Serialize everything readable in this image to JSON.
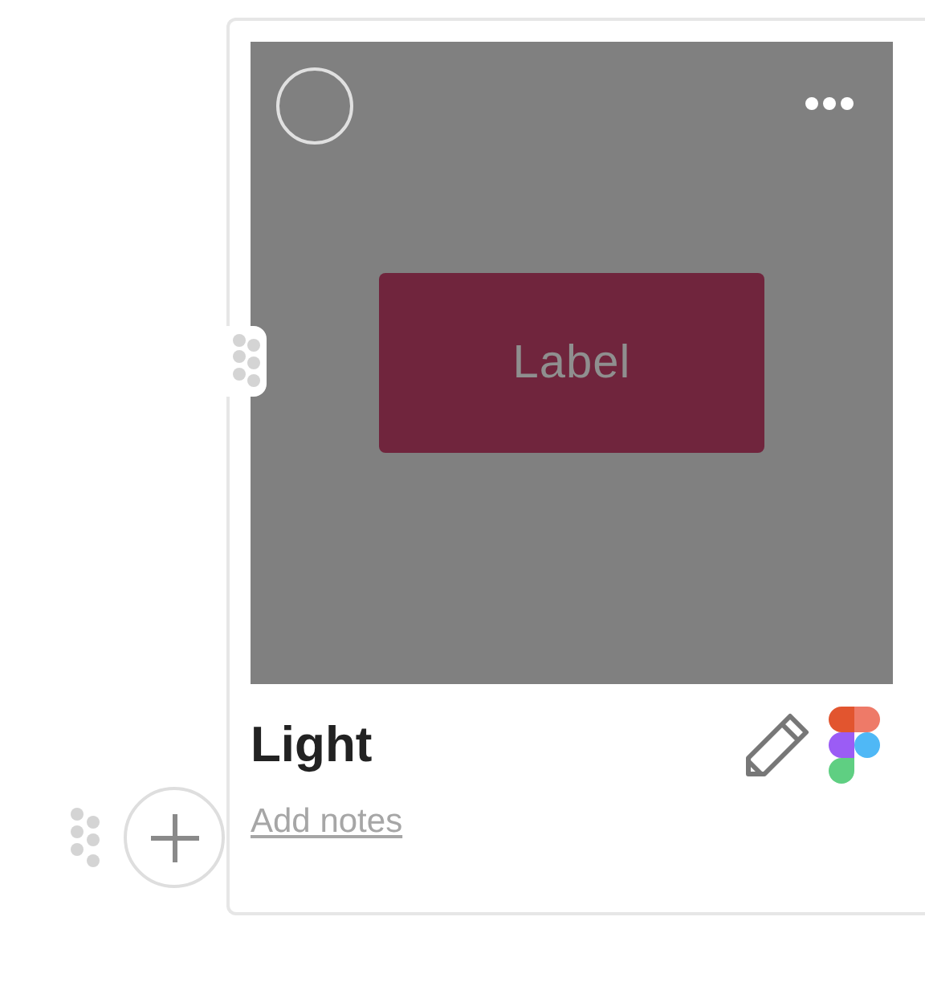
{
  "card": {
    "selected": false,
    "preview": {
      "label": "Label"
    },
    "title": "Light",
    "notes_link": "Add notes"
  }
}
